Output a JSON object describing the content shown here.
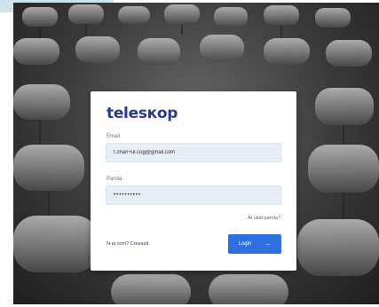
{
  "brand": {
    "logo_text": "telesкop"
  },
  "form": {
    "email_label": "Email",
    "email_value": "t.chan+ul.cog@gmail.com",
    "password_label": "Parola",
    "password_value": "••••••••••",
    "forgot_label": "Ai uitat parola?",
    "signup_label": "N-ai cont? Creează",
    "login_label": "Login",
    "login_icon": "arrow-right-icon"
  },
  "colors": {
    "accent": "#2f6fe0",
    "brand": "#2a3a8c",
    "field_bg": "#e8eef8",
    "corner_tag": "#cfe3ec"
  }
}
